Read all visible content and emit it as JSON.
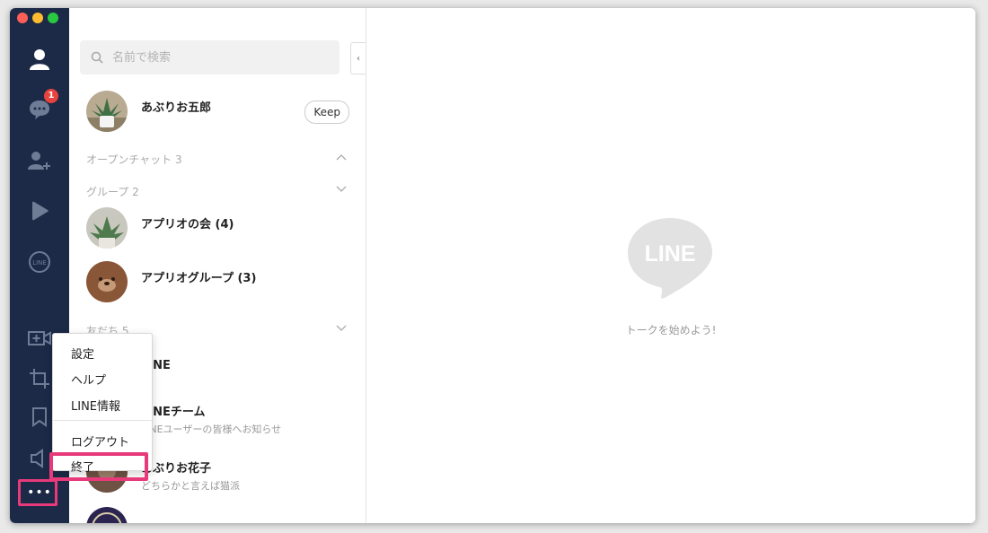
{
  "window": {
    "traffic_lights": [
      "close",
      "minimize",
      "zoom"
    ]
  },
  "sidebar": {
    "items": [
      {
        "name": "friends",
        "icon": "person-icon"
      },
      {
        "name": "chats",
        "icon": "chat-bubble-icon",
        "badge": "1"
      },
      {
        "name": "add-friends",
        "icon": "add-person-icon"
      },
      {
        "name": "timeline",
        "icon": "play-icon"
      },
      {
        "name": "line-services",
        "icon": "line-circle-icon"
      },
      {
        "name": "video-call",
        "icon": "video-plus-icon"
      },
      {
        "name": "screenshot",
        "icon": "crop-icon"
      },
      {
        "name": "keep",
        "icon": "bookmark-icon"
      },
      {
        "name": "announcement",
        "icon": "speaker-icon"
      },
      {
        "name": "more",
        "icon": "more-dots-icon"
      }
    ],
    "more_label": "•••"
  },
  "search": {
    "placeholder": "名前で検索"
  },
  "profile": {
    "name": "あぶりお五郎",
    "keep_label": "Keep"
  },
  "sections": {
    "open_chat": "オープンチャット 3",
    "groups": "グループ 2",
    "friends": "友だち 5"
  },
  "groups": [
    {
      "name": "アプリオの会 (4)"
    },
    {
      "name": "アプリオグループ (3)"
    }
  ],
  "friends": [
    {
      "name": "LINE",
      "status": ""
    },
    {
      "name": "LINEチーム",
      "status": "LINEユーザーの皆様へお知らせ"
    },
    {
      "name": "あぶりお花子",
      "status": "どちらかと言えば猫派"
    }
  ],
  "menu": {
    "items": [
      "設定",
      "ヘルプ",
      "LINE情報",
      "ログアウト",
      "終了"
    ]
  },
  "main": {
    "logo_text": "LINE",
    "empty_message": "トークを始めよう!"
  },
  "colors": {
    "sidebar_bg": "#1c2a47",
    "highlight": "#e83a7a",
    "line_green": "#06c755",
    "badge_red": "#e8433e"
  }
}
